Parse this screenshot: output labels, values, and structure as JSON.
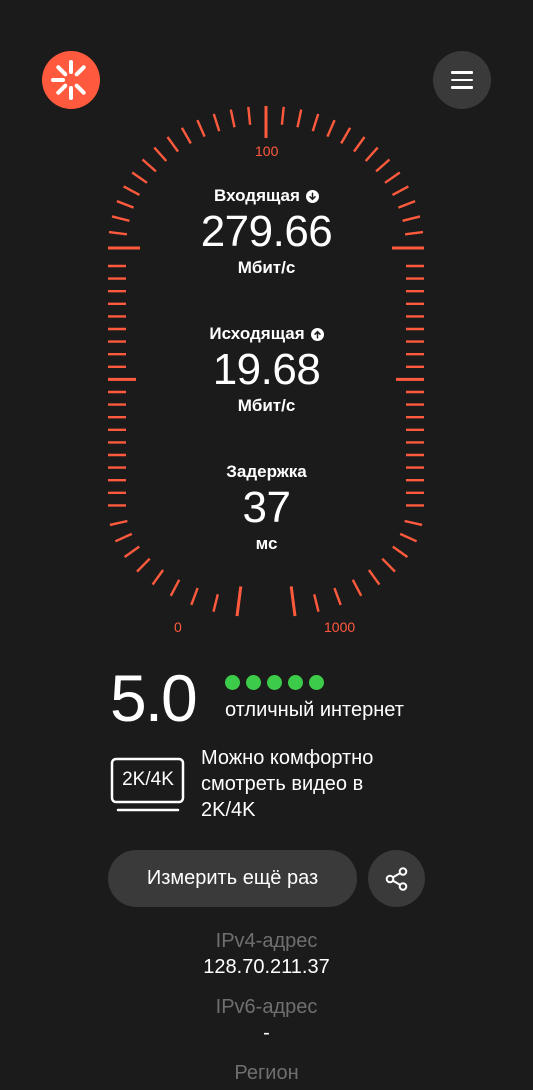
{
  "gauge": {
    "scale_top": "100",
    "scale_left": "0",
    "scale_right": "1000",
    "color": "#ff5a3d"
  },
  "download": {
    "label": "Входящая",
    "value": "279.66",
    "unit": "Мбит/с",
    "icon": "arrow-down-icon"
  },
  "upload": {
    "label": "Исходящая",
    "value": "19.68",
    "unit": "Мбит/с",
    "icon": "arrow-up-icon"
  },
  "latency": {
    "label": "Задержка",
    "value": "37",
    "unit": "мс"
  },
  "rating": {
    "score": "5.0",
    "dots": 5,
    "text": "отличный интернет",
    "color": "#3dcc4a"
  },
  "video": {
    "badge": "2K/4K",
    "text": "Можно комфортно смотреть видео в 2K/4K"
  },
  "actions": {
    "retry_label": "Измерить ещё раз",
    "share_icon": "share-icon"
  },
  "network": {
    "ipv4_label": "IPv4-адрес",
    "ipv4_value": "128.70.211.37",
    "ipv6_label": "IPv6-адрес",
    "ipv6_value": "-",
    "region_label": "Регион"
  }
}
